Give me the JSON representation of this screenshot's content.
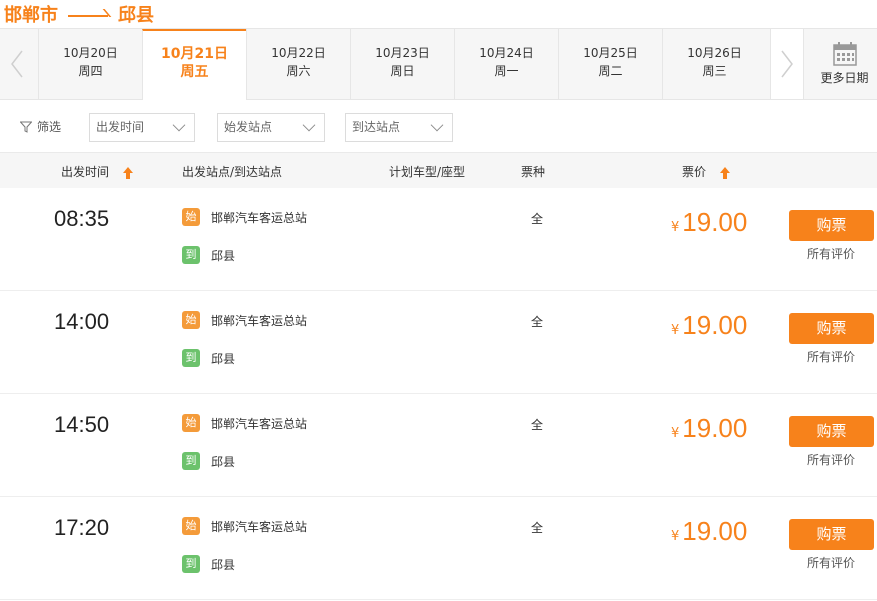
{
  "route": {
    "from": "邯郸市",
    "to": "邱县"
  },
  "dates": [
    {
      "date": "10月20日",
      "weekday": "周四",
      "active": false
    },
    {
      "date": "10月21日",
      "weekday": "周五",
      "active": true
    },
    {
      "date": "10月22日",
      "weekday": "周六",
      "active": false
    },
    {
      "date": "10月23日",
      "weekday": "周日",
      "active": false
    },
    {
      "date": "10月24日",
      "weekday": "周一",
      "active": false
    },
    {
      "date": "10月25日",
      "weekday": "周二",
      "active": false
    },
    {
      "date": "10月26日",
      "weekday": "周三",
      "active": false
    }
  ],
  "more_dates_label": "更多日期",
  "filters": {
    "label": "筛选",
    "departure_time": "出发时间",
    "start_station": "始发站点",
    "arrival_station": "到达站点"
  },
  "table_headers": {
    "departure_time": "出发时间",
    "stations": "出发站点/到达站点",
    "vehicle": "计划车型/座型",
    "ticket_type": "票种",
    "price": "票价"
  },
  "rows": [
    {
      "time": "08:35",
      "start_tag": "始",
      "start": "邯郸汽车客运总站",
      "end_tag": "到",
      "end": "邱县",
      "ticket_type": "全",
      "currency": "¥",
      "price": "19.00",
      "buy_label": "购票",
      "reviews_label": "所有评价"
    },
    {
      "time": "14:00",
      "start_tag": "始",
      "start": "邯郸汽车客运总站",
      "end_tag": "到",
      "end": "邱县",
      "ticket_type": "全",
      "currency": "¥",
      "price": "19.00",
      "buy_label": "购票",
      "reviews_label": "所有评价"
    },
    {
      "time": "14:50",
      "start_tag": "始",
      "start": "邯郸汽车客运总站",
      "end_tag": "到",
      "end": "邱县",
      "ticket_type": "全",
      "currency": "¥",
      "price": "19.00",
      "buy_label": "购票",
      "reviews_label": "所有评价"
    },
    {
      "time": "17:20",
      "start_tag": "始",
      "start": "邯郸汽车客运总站",
      "end_tag": "到",
      "end": "邱县",
      "ticket_type": "全",
      "currency": "¥",
      "price": "19.00",
      "buy_label": "购票",
      "reviews_label": "所有评价"
    }
  ],
  "colors": {
    "accent": "#f7821b",
    "start_tag": "#f49b3a",
    "end_tag": "#6cc26c"
  },
  "icons": {
    "prev": "chevron-left-icon",
    "next": "chevron-right-icon",
    "calendar": "calendar-icon",
    "filter": "filter-icon",
    "sort": "sort-up-arrow-icon"
  }
}
